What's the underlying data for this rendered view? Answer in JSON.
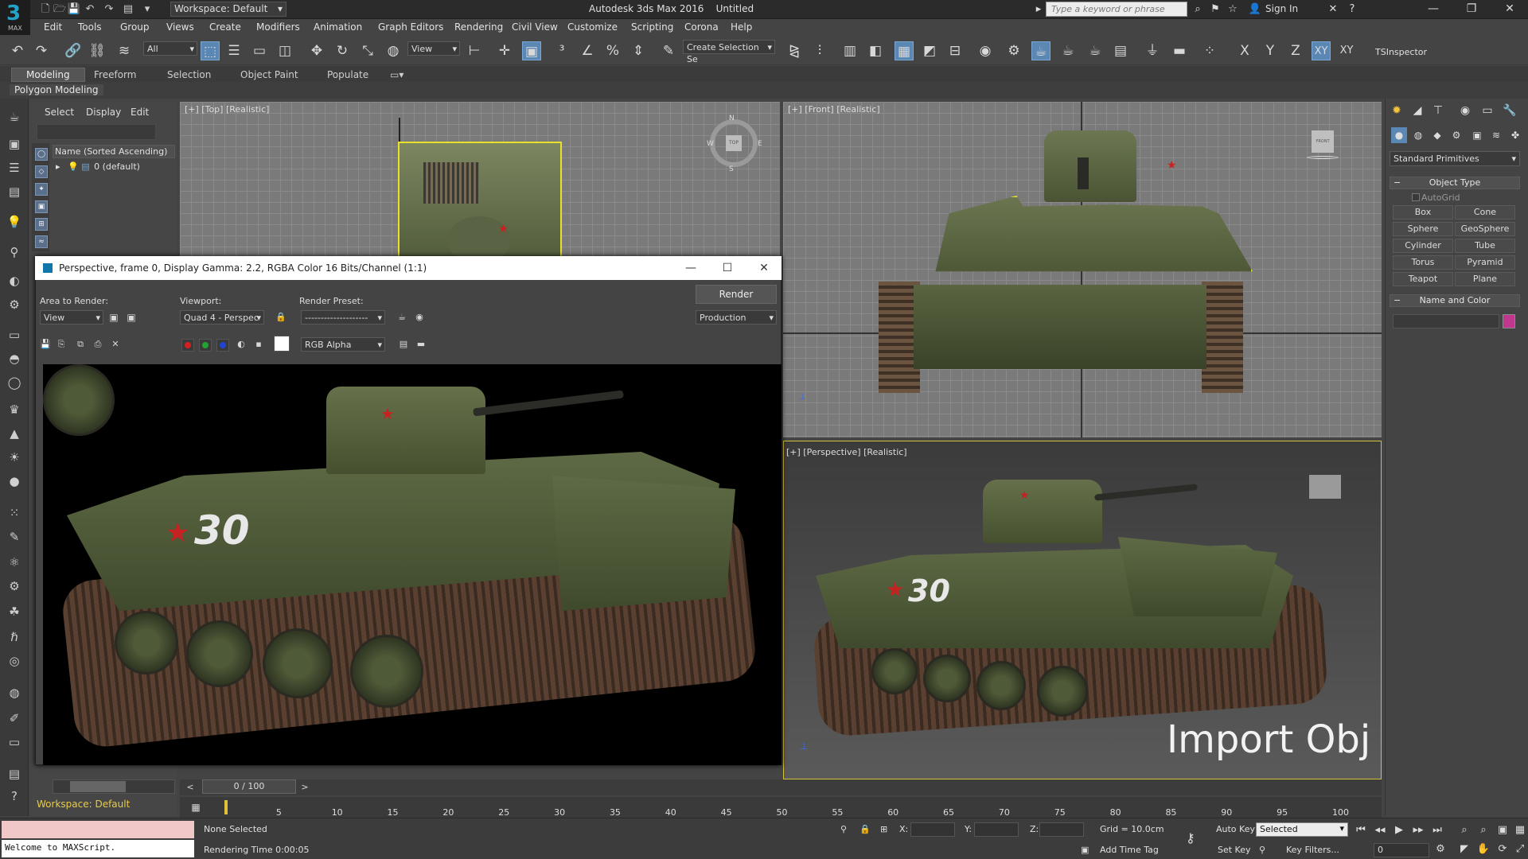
{
  "titlebar": {
    "logo_text": "MAX",
    "workspace": "Workspace: Default",
    "app_title": "Autodesk 3ds Max 2016",
    "doc_title": "Untitled",
    "search_placeholder": "Type a keyword or phrase",
    "sign_in": "Sign In"
  },
  "menu": [
    "Edit",
    "Tools",
    "Group",
    "Views",
    "Create",
    "Modifiers",
    "Animation",
    "Graph Editors",
    "Rendering",
    "Civil View",
    "Customize",
    "Scripting",
    "Corona",
    "Help"
  ],
  "toolbar": {
    "filter_value": "All",
    "ref_coord_value": "View",
    "selection_set_value": "Create Selection Se",
    "axis_x": "X",
    "axis_y": "Y",
    "axis_z": "Z",
    "axis_xy": "XY",
    "axis_xy2": "XY",
    "tsinspector": "TSInspector"
  },
  "ribbon": {
    "tabs": [
      "Modeling",
      "Freeform",
      "Selection",
      "Object Paint",
      "Populate"
    ],
    "panel": "Polygon Modeling"
  },
  "scene_explorer": {
    "tabs": [
      "Select",
      "Display",
      "Edit"
    ],
    "column_header": "Name (Sorted Ascending)",
    "row_label": "0 (default)",
    "workspace_label": "Workspace: Default"
  },
  "viewports": {
    "top_label": "[+] [Top] [Realistic]",
    "front_label": "[+] [Front] [Realistic]",
    "persp_label": "[+] [Perspective] [Realistic]",
    "compass_n": "N",
    "compass_s": "S",
    "compass_w": "W",
    "compass_e": "E",
    "compass_top": "TOP",
    "viewcube_front": "FRONT"
  },
  "render_window": {
    "title": "Perspective, frame 0, Display Gamma: 2.2, RGBA Color 16 Bits/Channel (1:1)",
    "area_label": "Area to Render:",
    "area_value": "View",
    "viewport_label": "Viewport:",
    "viewport_value": "Quad 4 - Perspec",
    "preset_label": "Render Preset:",
    "preset_value": "--------------------",
    "render_button": "Render",
    "production_value": "Production",
    "channel_value": "RGB Alpha"
  },
  "tank": {
    "number": "30"
  },
  "watermark": "Import Obj",
  "command_panel": {
    "primitives_value": "Standard Primitives",
    "object_type": "Object Type",
    "autogrid": "AutoGrid",
    "buttons": [
      "Box",
      "Cone",
      "Sphere",
      "GeoSphere",
      "Cylinder",
      "Tube",
      "Torus",
      "Pyramid",
      "Teapot",
      "Plane"
    ],
    "name_and_color": "Name and Color",
    "swatch_color": "#c0378f"
  },
  "timeline": {
    "slider_text": "0 / 100",
    "ticks": [
      "5",
      "10",
      "15",
      "20",
      "25",
      "30",
      "35",
      "40",
      "45",
      "50",
      "55",
      "60",
      "65",
      "70",
      "75",
      "80",
      "85",
      "90",
      "95",
      "100"
    ]
  },
  "status": {
    "maxscript_text": "Welcome to MAXScript.",
    "selection_status": "None Selected",
    "rendering_time": "Rendering Time  0:00:05",
    "x_label": "X:",
    "y_label": "Y:",
    "z_label": "Z:",
    "grid": "Grid = 10.0cm",
    "add_time_tag": "Add Time Tag",
    "auto_key": "Auto Key",
    "set_key": "Set Key",
    "selected_value": "Selected",
    "key_filters": "Key Filters...",
    "frame_value": "0"
  }
}
